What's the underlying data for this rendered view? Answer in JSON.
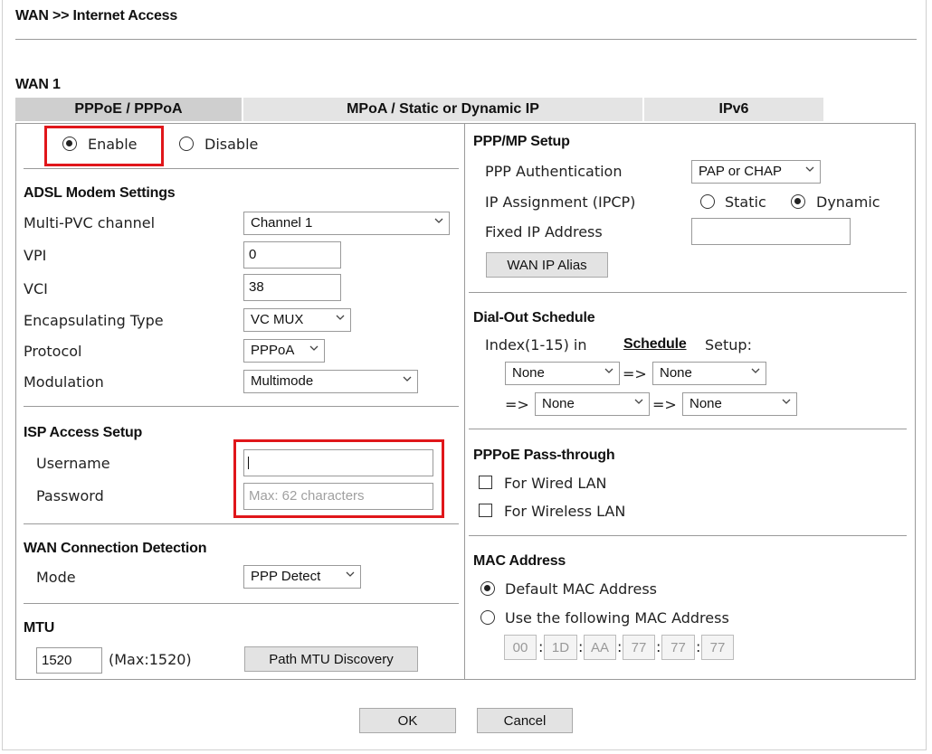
{
  "breadcrumb": "WAN >> Internet Access",
  "wan_title": "WAN 1",
  "tabs": [
    "PPPoE / PPPoA",
    "MPoA / Static or Dynamic IP",
    "IPv6"
  ],
  "enable_label": "Enable",
  "disable_label": "Disable",
  "adsl": {
    "title": "ADSL Modem Settings",
    "multi_pvc_label": "Multi-PVC channel",
    "multi_pvc_value": "Channel 1",
    "vpi_label": "VPI",
    "vpi_value": "0",
    "vci_label": "VCI",
    "vci_value": "38",
    "encap_label": "Encapsulating Type",
    "encap_value": "VC MUX",
    "protocol_label": "Protocol",
    "protocol_value": "PPPoA",
    "modulation_label": "Modulation",
    "modulation_value": "Multimode"
  },
  "isp": {
    "title": "ISP Access Setup",
    "username_label": "Username",
    "username_value": "",
    "password_label": "Password",
    "password_placeholder": "Max: 62 characters"
  },
  "detection": {
    "title": "WAN Connection Detection",
    "mode_label": "Mode",
    "mode_value": "PPP Detect"
  },
  "mtu": {
    "title": "MTU",
    "value": "1520",
    "max_text": "(Max:1520)",
    "discovery_button": "Path MTU Discovery"
  },
  "ppp": {
    "title": "PPP/MP Setup",
    "auth_label": "PPP Authentication",
    "auth_value": "PAP or CHAP",
    "ip_assign_label": "IP Assignment (IPCP)",
    "static_label": "Static",
    "dynamic_label": "Dynamic",
    "fixed_ip_label": "Fixed IP Address",
    "fixed_ip_value": "",
    "alias_button": "WAN IP Alias"
  },
  "schedule": {
    "title": "Dial-Out Schedule",
    "index_text": "Index(1-15) in",
    "link_text": "Schedule",
    "setup_text": "Setup:",
    "arrow": "=>",
    "slots": [
      "None",
      "None",
      "None",
      "None"
    ]
  },
  "passthrough": {
    "title": "PPPoE Pass-through",
    "wired_label": "For Wired LAN",
    "wireless_label": "For Wireless LAN"
  },
  "mac": {
    "title": "MAC Address",
    "default_label": "Default MAC Address",
    "custom_label": "Use the following MAC Address",
    "octets": [
      "00",
      "1D",
      "AA",
      "77",
      "77",
      "77"
    ]
  },
  "footer": {
    "ok": "OK",
    "cancel": "Cancel"
  },
  "colors": {
    "highlight": "#e0161a",
    "active_tab": "#cfcfcf",
    "inactive_tab": "#e4e4e4"
  }
}
